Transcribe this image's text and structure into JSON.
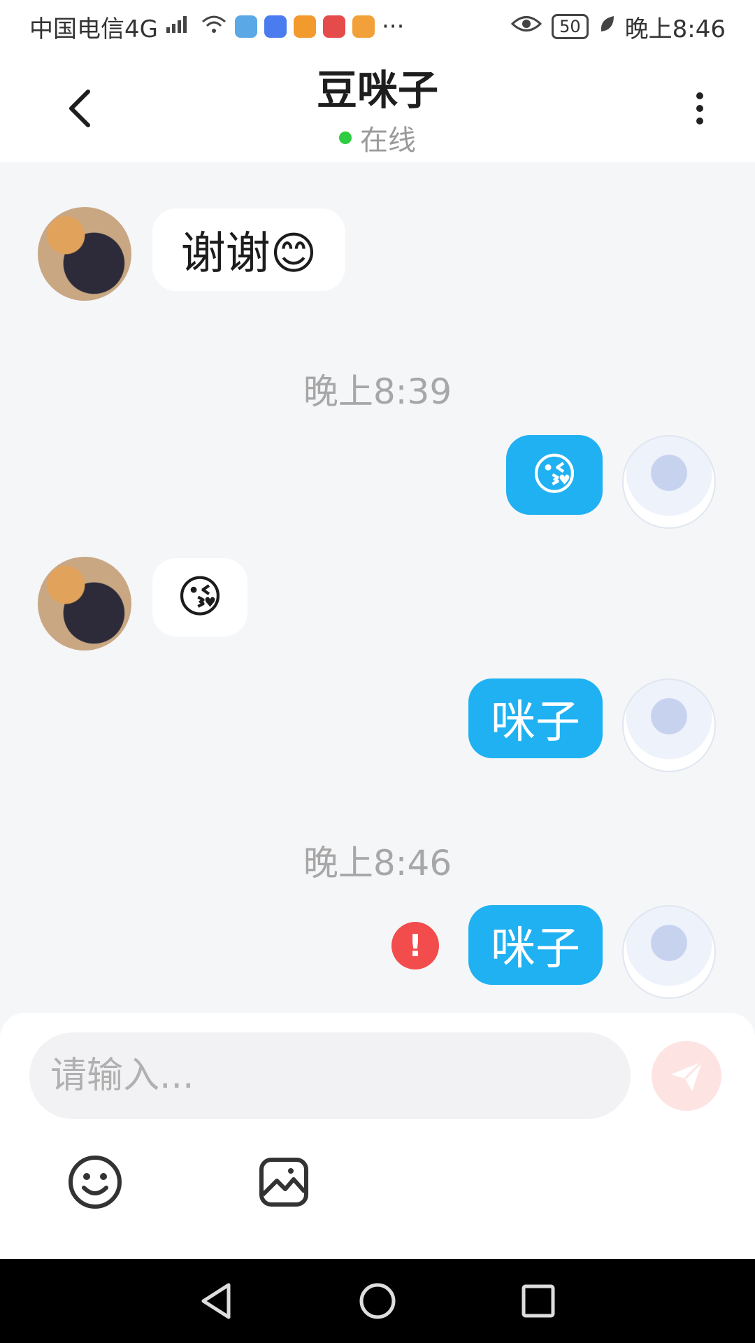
{
  "status_bar": {
    "carrier": "中国电信4G",
    "battery": "50",
    "time": "晚上8:46",
    "more": "···",
    "app_icon_colors": [
      "#5aa9e6",
      "#4a7cf0",
      "#f39a2c",
      "#e64b4b",
      "#f2a13a"
    ]
  },
  "header": {
    "contact_name": "豆咪子",
    "presence": "在线"
  },
  "messages": [
    {
      "side": "in",
      "avatar": "cat-girl",
      "text": "谢谢😊"
    },
    {
      "timestamp": "晚上8:39"
    },
    {
      "side": "out",
      "avatar": "blue-girl",
      "text": "😘"
    },
    {
      "side": "in",
      "avatar": "cat-girl",
      "text": "😘"
    },
    {
      "side": "out",
      "avatar": "blue-girl",
      "text": "咪子"
    },
    {
      "timestamp": "晚上8:46"
    },
    {
      "side": "out",
      "avatar": "blue-girl",
      "text": "咪子",
      "status": "failed",
      "status_icon": "!"
    }
  ],
  "composer": {
    "placeholder": "请输入...",
    "tools": [
      "emoji-icon",
      "image-icon"
    ],
    "send_icon": "paper-plane-icon"
  },
  "colors": {
    "outgoing_bubble": "#1fb1f2",
    "incoming_bubble": "#ffffff",
    "online": "#2ecc40",
    "error": "#f24c4c",
    "send_disabled": "#fde4e2"
  }
}
